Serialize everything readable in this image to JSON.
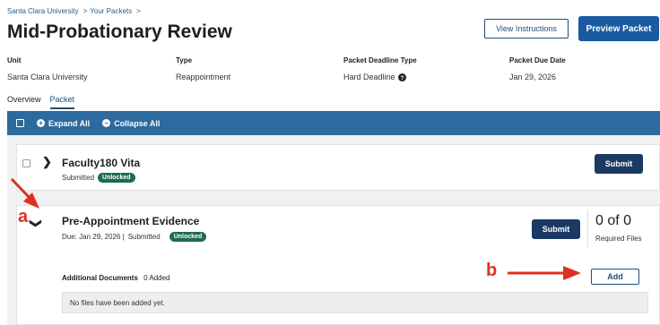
{
  "breadcrumb": [
    "Santa Clara University",
    "Your Packets"
  ],
  "breadcrumb_separator": ">",
  "page_title": "Mid-Probationary Review",
  "header_buttons": {
    "view_instructions": "View Instructions",
    "preview_packet": "Preview Packet"
  },
  "meta": [
    {
      "label": "Unit",
      "value": "Santa Clara University"
    },
    {
      "label": "Type",
      "value": "Reappointment"
    },
    {
      "label": "Packet Deadline Type",
      "value": "Hard Deadline"
    },
    {
      "label": "Packet Due Date",
      "value": "Jan 29, 2026"
    }
  ],
  "tabs": [
    {
      "label": "Overview",
      "active": false
    },
    {
      "label": "Packet",
      "active": true
    }
  ],
  "toolbar": {
    "expand_all": "Expand All",
    "collapse_all": "Collapse All"
  },
  "sections": [
    {
      "title": "Faculty180 Vita",
      "status": "Submitted",
      "badge": "Unlocked",
      "submit_label": "Submit",
      "expanded": false
    },
    {
      "title": "Pre-Appointment Evidence",
      "due": "Due: Jan 29, 2026 |",
      "status": "Submitted",
      "badge": "Unlocked",
      "submit_label": "Submit",
      "required_count": "0 of 0",
      "required_label": "Required Files",
      "additional_label": "Additional Documents",
      "additional_count": "0 Added",
      "add_label": "Add",
      "empty_message": "No files have been added yet.",
      "expanded": true
    }
  ],
  "annotations": {
    "a": "a",
    "b": "b",
    "color": "#e03020"
  },
  "colors": {
    "toolbar": "#2d6a9f",
    "primary_button": "#1a5aa0",
    "submit_button": "#1b3a63",
    "badge": "#1f6b50"
  },
  "icons": {
    "help": "question-circle-icon",
    "expand": "plus-circle-icon",
    "collapse": "minus-circle-icon"
  }
}
